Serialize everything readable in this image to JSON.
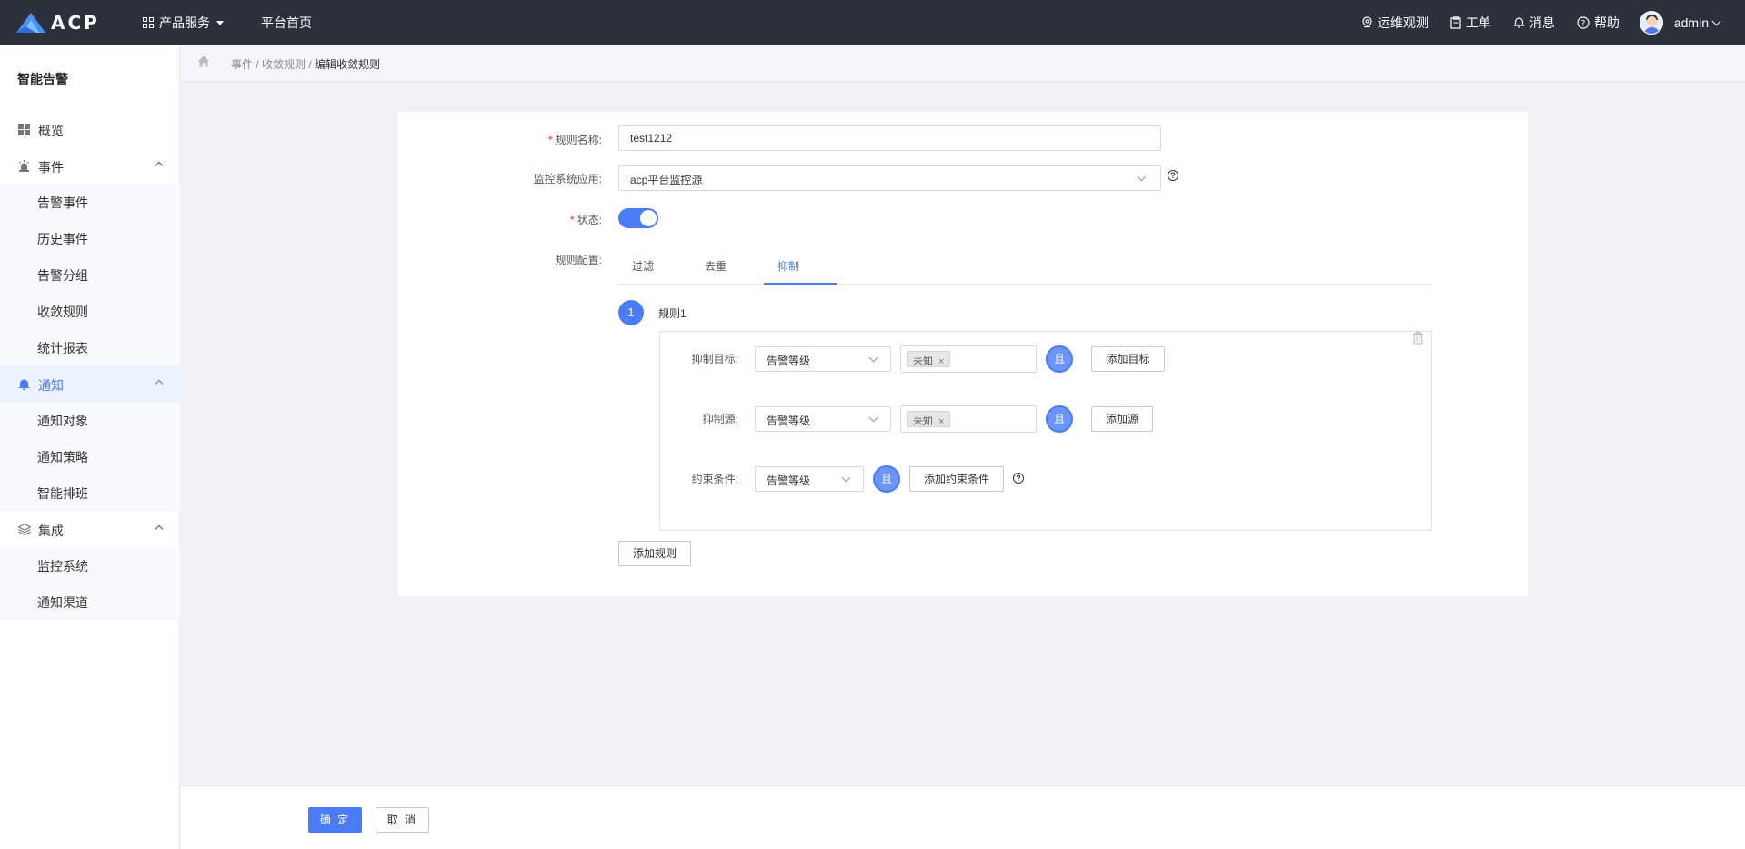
{
  "header": {
    "logo_text": "ACP",
    "product_menu": "产品服务",
    "platform_home": "平台首页",
    "ops_observe": "运维观测",
    "work_order": "工单",
    "messages": "消息",
    "help": "帮助",
    "username": "admin"
  },
  "sidebar": {
    "title": "智能告警",
    "overview": "概览",
    "events": {
      "label": "事件",
      "items": [
        "告警事件",
        "历史事件",
        "告警分组",
        "收敛规则",
        "统计报表"
      ]
    },
    "notify": {
      "label": "通知",
      "items": [
        "通知对象",
        "通知策略",
        "智能排班"
      ]
    },
    "integration": {
      "label": "集成",
      "items": [
        "监控系统",
        "通知渠道"
      ]
    }
  },
  "breadcrumb": {
    "items": [
      "事件",
      "收敛规则"
    ],
    "separator": "/",
    "current": "编辑收敛规则"
  },
  "form": {
    "rule_name_label": "规则名称:",
    "rule_name_value": "test1212",
    "monitor_app_label": "监控系统应用:",
    "monitor_app_value": "acp平台监控源",
    "status_label": "状态:",
    "status_on": true,
    "rule_config_label": "规则配置:",
    "tabs": [
      "过滤",
      "去重",
      "抑制"
    ],
    "active_tab": "抑制",
    "rule": {
      "index": "1",
      "title": "规则1",
      "target_label": "抑制目标:",
      "target_field": "告警等级",
      "target_tag": "未知",
      "source_label": "抑制源:",
      "source_field": "告警等级",
      "source_tag": "未知",
      "constraint_label": "约束条件:",
      "constraint_field": "告警等级",
      "and_label": "且",
      "add_target": "添加目标",
      "add_source": "添加源",
      "add_constraint": "添加约束条件"
    },
    "add_rule": "添加规则"
  },
  "footer": {
    "confirm": "确 定",
    "cancel": "取 消"
  },
  "colors": {
    "primary": "#4a7cf7",
    "topbar": "#2b303b",
    "required": "#f5222d"
  }
}
